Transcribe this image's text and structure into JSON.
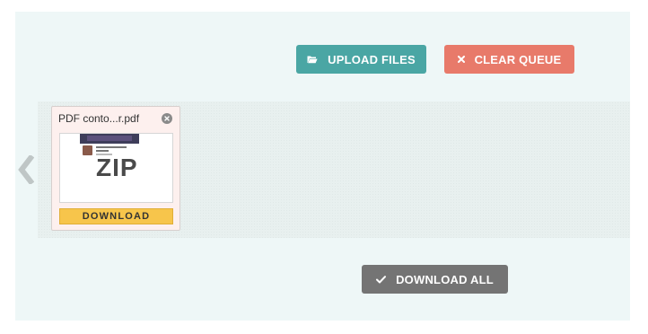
{
  "toolbar": {
    "upload_label": "UPLOAD FILES",
    "upload_icon": "folder-open-icon",
    "clear_label": "CLEAR QUEUE",
    "clear_icon": "close-icon"
  },
  "colors": {
    "upload": "#4aa6a4",
    "clear": "#e87a6a",
    "download_all": "#747474",
    "download": "#f7c54b",
    "card_bg": "#fdf0ee",
    "panel_bg": "#eef7f7"
  },
  "queue": {
    "prev_icon": "chevron-left-icon",
    "files": [
      {
        "name": "PDF conto...r.pdf",
        "remove_icon": "close-circle-icon",
        "thumbnail_text": "ZIP",
        "download_label": "DOWNLOAD"
      }
    ]
  },
  "footer": {
    "download_all_label": "DOWNLOAD ALL",
    "download_all_icon": "checkmark-icon"
  }
}
